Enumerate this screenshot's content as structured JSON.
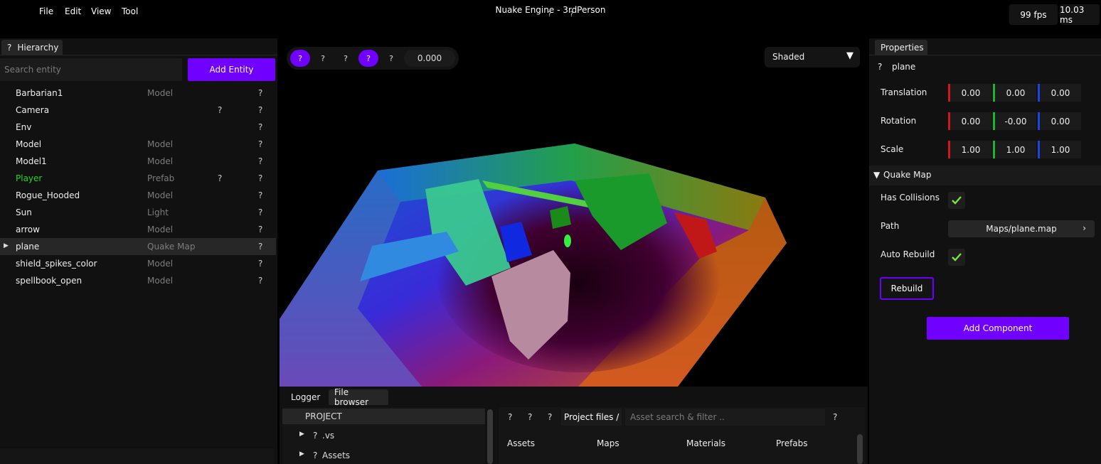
{
  "menu": [
    "File",
    "Edit",
    "View",
    "Tool"
  ],
  "window": {
    "title": "Nuake Engine - 3rdPerson",
    "title_marks": [
      "?",
      "?"
    ]
  },
  "stats": {
    "fps": "99 fps",
    "ms": "10.03 ms"
  },
  "hierarchy": {
    "tab_icon": "?",
    "tab_label": "Hierarchy",
    "search_placeholder": "Search entity",
    "add_button": "Add Entity",
    "entities": [
      {
        "name": "Barbarian1",
        "type": "Model",
        "flag": "",
        "icon": "?"
      },
      {
        "name": "Camera",
        "type": "",
        "flag": "?",
        "icon": "?"
      },
      {
        "name": "Env",
        "type": "",
        "flag": "",
        "icon": "?"
      },
      {
        "name": "Model",
        "type": "Model",
        "flag": "",
        "icon": "?"
      },
      {
        "name": "Model1",
        "type": "Model",
        "flag": "",
        "icon": "?"
      },
      {
        "name": "Player",
        "type": "Prefab",
        "flag": "?",
        "icon": "?"
      },
      {
        "name": "Rogue_Hooded",
        "type": "Model",
        "flag": "",
        "icon": "?"
      },
      {
        "name": "Sun",
        "type": "Light",
        "flag": "",
        "icon": "?"
      },
      {
        "name": "arrow",
        "type": "Model",
        "flag": "",
        "icon": "?"
      },
      {
        "name": "plane",
        "type": "Quake Map",
        "flag": "",
        "icon": "?"
      },
      {
        "name": "shield_spikes_color",
        "type": "Model",
        "flag": "",
        "icon": "?"
      },
      {
        "name": "spellbook_open",
        "type": "Model",
        "flag": "",
        "icon": "?"
      }
    ],
    "arrow": "▶"
  },
  "colors": {
    "accent": "#7000ff",
    "prefab_text": "#20d820",
    "x_axis": "#d01818",
    "y_axis": "#19b52b",
    "z_axis": "#1a47e0",
    "check": "#7ee33b"
  },
  "viewport": {
    "tools": [
      "?",
      "?",
      "?",
      "?",
      "?"
    ],
    "time": "0.000",
    "shading": "Shaded",
    "shading_arrow": "▼"
  },
  "bottom": {
    "tabs": [
      "Logger",
      "File browser"
    ],
    "tree_root": "PROJECT",
    "tree_items": [
      {
        "icon": "?",
        "label": ".vs"
      },
      {
        "icon": "?",
        "label": "Assets"
      }
    ],
    "tree_arrow": "▶",
    "nav_icons": [
      "?",
      "?",
      "?"
    ],
    "breadcrumb": "Project files /",
    "asset_search_placeholder": "Asset search & filter ..",
    "search_icon": "?",
    "folders": [
      "Assets",
      "Maps",
      "Materials",
      "Prefabs"
    ]
  },
  "properties": {
    "tab_label": "Properties",
    "entity_icon": "?",
    "entity_name": "plane",
    "transform": [
      {
        "label": "Translation",
        "values": [
          "0.00",
          "0.00",
          "0.00"
        ]
      },
      {
        "label": "Rotation",
        "values": [
          "0.00",
          "-0.00",
          "0.00"
        ]
      },
      {
        "label": "Scale",
        "values": [
          "1.00",
          "1.00",
          "1.00"
        ]
      }
    ],
    "quake_map": {
      "header": "Quake Map",
      "arrow": "▼",
      "has_collisions_label": "Has Collisions",
      "has_collisions": true,
      "path_label": "Path",
      "path": "Maps/plane.map",
      "path_chevron": "›",
      "auto_rebuild_label": "Auto Rebuild",
      "auto_rebuild": true,
      "rebuild_button": "Rebuild"
    },
    "add_component": "Add Component"
  }
}
